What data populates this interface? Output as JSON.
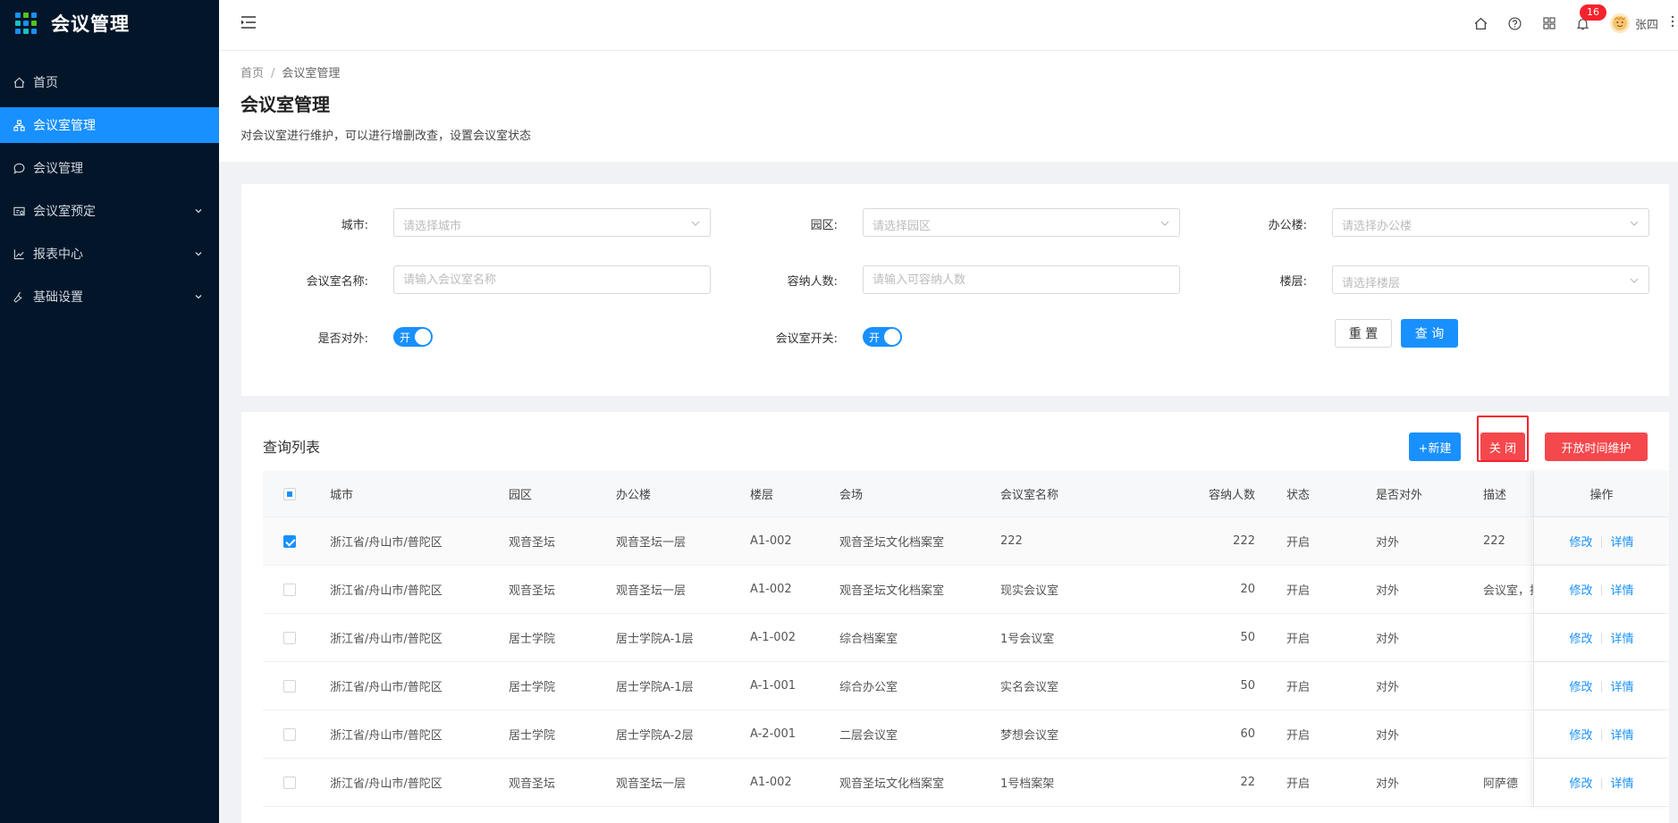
{
  "app": {
    "title": "会议管理"
  },
  "sidebar": {
    "items": [
      {
        "label": "首页",
        "icon": "home-icon"
      },
      {
        "label": "会议室管理",
        "icon": "meeting-room-icon",
        "active": true
      },
      {
        "label": "会议管理",
        "icon": "chat-icon"
      },
      {
        "label": "会议室预定",
        "icon": "booking-icon",
        "expandable": true
      },
      {
        "label": "报表中心",
        "icon": "chart-icon",
        "expandable": true
      },
      {
        "label": "基础设置",
        "icon": "wrench-icon",
        "expandable": true
      }
    ]
  },
  "header": {
    "notification_count": "16",
    "user_name": "张四"
  },
  "page": {
    "breadcrumb_home": "首页",
    "breadcrumb_sep": "/",
    "breadcrumb_current": "会议室管理",
    "title": "会议室管理",
    "description": "对会议室进行维护，可以进行增删改查，设置会议室状态"
  },
  "filters": {
    "city_label": "城市:",
    "city_placeholder": "请选择城市",
    "park_label": "园区:",
    "park_placeholder": "请选择园区",
    "building_label": "办公楼:",
    "building_placeholder": "请选择办公楼",
    "room_name_label": "会议室名称:",
    "room_name_placeholder": "请输入会议室名称",
    "capacity_label": "容纳人数:",
    "capacity_placeholder": "请输入可容纳人数",
    "floor_label": "楼层:",
    "floor_placeholder": "请选择楼层",
    "external_label": "是否对外:",
    "external_switch_text": "开",
    "room_switch_label": "会议室开关:",
    "room_switch_text": "开",
    "reset_label": "重 置",
    "query_label": "查 询"
  },
  "list": {
    "title": "查询列表",
    "new_label": "+新建",
    "close_label": "关 闭",
    "open_time_label": "开放时间维护",
    "columns": {
      "city": "城市",
      "park": "园区",
      "building": "办公楼",
      "floor": "楼层",
      "venue": "会场",
      "room_name": "会议室名称",
      "capacity": "容纳人数",
      "status": "状态",
      "external": "是否对外",
      "description": "描述",
      "ops": "操作"
    },
    "edit_label": "修改",
    "detail_label": "详情",
    "rows": [
      {
        "city": "浙江省/舟山市/普陀区",
        "park": "观音圣坛",
        "building": "观音圣坛一层",
        "floor": "A1-002",
        "venue": "观音圣坛文化档案室",
        "room_name": "222",
        "capacity": "222",
        "status": "开启",
        "external": "对外",
        "description": "222",
        "checked": true
      },
      {
        "city": "浙江省/舟山市/普陀区",
        "park": "观音圣坛",
        "building": "观音圣坛一层",
        "floor": "A1-002",
        "venue": "观音圣坛文化档案室",
        "room_name": "现实会议室",
        "capacity": "20",
        "status": "开启",
        "external": "对外",
        "description": "会议室，指供",
        "checked": false
      },
      {
        "city": "浙江省/舟山市/普陀区",
        "park": "居士学院",
        "building": "居士学院A-1层",
        "floor": "A-1-002",
        "venue": "综合档案室",
        "room_name": "1号会议室",
        "capacity": "50",
        "status": "开启",
        "external": "对外",
        "description": "",
        "checked": false
      },
      {
        "city": "浙江省/舟山市/普陀区",
        "park": "居士学院",
        "building": "居士学院A-1层",
        "floor": "A-1-001",
        "venue": "综合办公室",
        "room_name": "实名会议室",
        "capacity": "50",
        "status": "开启",
        "external": "对外",
        "description": "",
        "checked": false
      },
      {
        "city": "浙江省/舟山市/普陀区",
        "park": "居士学院",
        "building": "居士学院A-2层",
        "floor": "A-2-001",
        "venue": "二层会议室",
        "room_name": "梦想会议室",
        "capacity": "60",
        "status": "开启",
        "external": "对外",
        "description": "",
        "checked": false
      },
      {
        "city": "浙江省/舟山市/普陀区",
        "park": "观音圣坛",
        "building": "观音圣坛一层",
        "floor": "A1-002",
        "venue": "观音圣坛文化档案室",
        "room_name": "1号档案架",
        "capacity": "22",
        "status": "开启",
        "external": "对外",
        "description": "阿萨德",
        "checked": false
      }
    ]
  }
}
